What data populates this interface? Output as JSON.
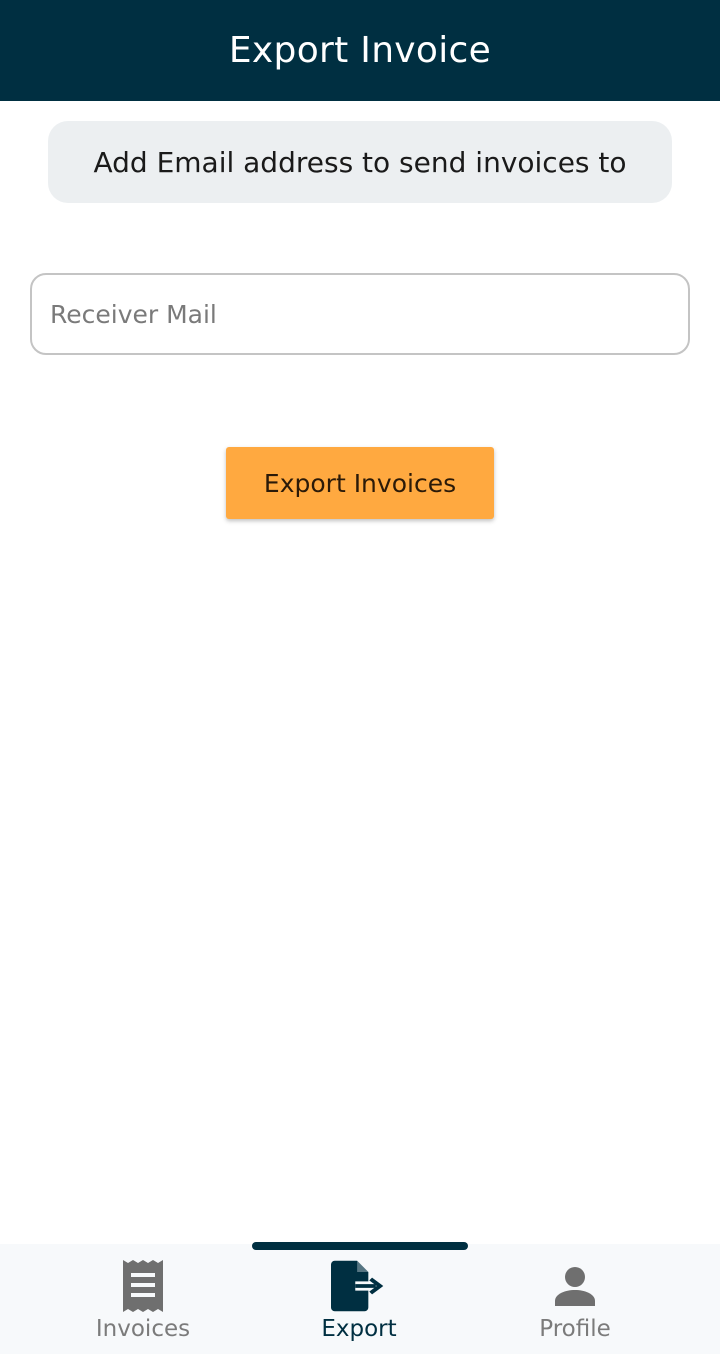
{
  "app_bar": {
    "title": "Export Invoice"
  },
  "info_chip": {
    "text": "Add Email address to send invoices to"
  },
  "receiver_field": {
    "placeholder": "Receiver Mail",
    "value": ""
  },
  "export_button": {
    "label": "Export Invoices"
  },
  "bottom_nav": {
    "items": [
      {
        "label": "Invoices",
        "icon": "receipt-icon",
        "active": false
      },
      {
        "label": "Export",
        "icon": "file-export-icon",
        "active": true
      },
      {
        "label": "Profile",
        "icon": "person-icon",
        "active": false
      }
    ]
  },
  "colors": {
    "app_bar": "#002f41",
    "accent_button": "#ffa940",
    "chip_background": "#eceff1",
    "nav_active": "#002f41",
    "nav_inactive": "#7b7b7b"
  }
}
